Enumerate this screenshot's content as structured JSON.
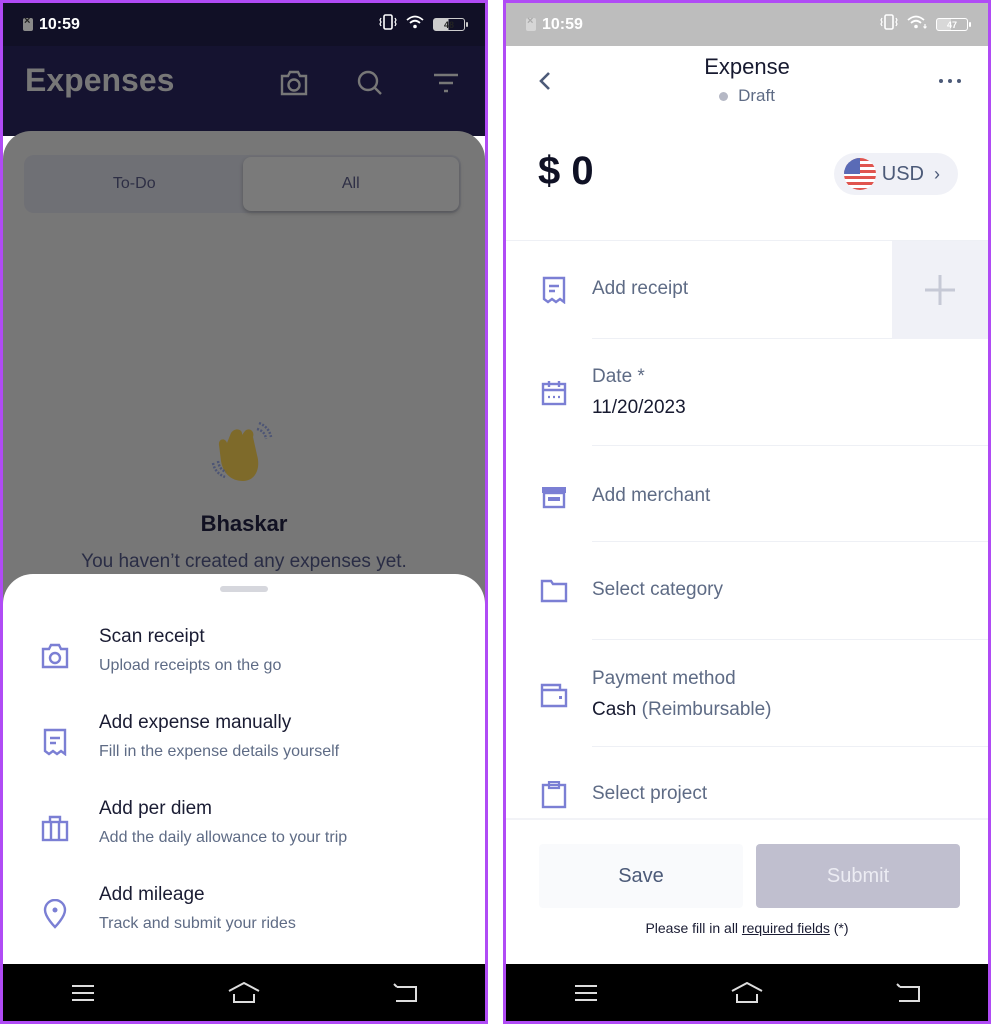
{
  "left": {
    "status_bar": {
      "time": "10:59",
      "battery": "48"
    },
    "header": {
      "title": "Expenses",
      "actions": [
        "camera-icon",
        "search-icon",
        "filter-icon"
      ]
    },
    "segmented": {
      "tabs": [
        {
          "label": "To-Do",
          "active": false
        },
        {
          "label": "All",
          "active": true
        }
      ]
    },
    "empty_state": {
      "icon": "waving-hand-icon",
      "name": "Bhaskar",
      "message": "You haven’t created any expenses yet."
    },
    "sheet": {
      "items": [
        {
          "icon": "camera-icon",
          "title": "Scan receipt",
          "subtitle": "Upload receipts on the go"
        },
        {
          "icon": "receipt-icon",
          "title": "Add expense manually",
          "subtitle": "Fill in the expense details yourself"
        },
        {
          "icon": "suitcase-icon",
          "title": "Add per diem",
          "subtitle": "Add the daily allowance to your trip"
        },
        {
          "icon": "location-pin-icon",
          "title": "Add mileage",
          "subtitle": "Track and submit your rides"
        }
      ]
    }
  },
  "right": {
    "status_bar": {
      "time": "10:59",
      "battery": "47"
    },
    "header": {
      "title": "Expense",
      "status": "Draft"
    },
    "amount": "$ 0",
    "currency": {
      "code": "USD",
      "flag": "us-flag-icon"
    },
    "fields": {
      "receipt": {
        "label": "Add receipt"
      },
      "date": {
        "label": "Date *",
        "value": "11/20/2023"
      },
      "merchant": {
        "label": "Add merchant"
      },
      "category": {
        "label": "Select category"
      },
      "payment": {
        "label": "Payment method",
        "value": "Cash",
        "value_note": "(Reimbursable)"
      },
      "project": {
        "label": "Select project"
      }
    },
    "footer": {
      "save_label": "Save",
      "submit_label": "Submit",
      "hint_prefix": "Please fill in all ",
      "hint_link": "required fields",
      "hint_suffix": " (*)"
    }
  },
  "colors": {
    "accent_icon": "#7b7fd4",
    "frame_border": "#b04bf5",
    "header_dark": "#151330",
    "submit_disabled": "#c0bfcf"
  }
}
